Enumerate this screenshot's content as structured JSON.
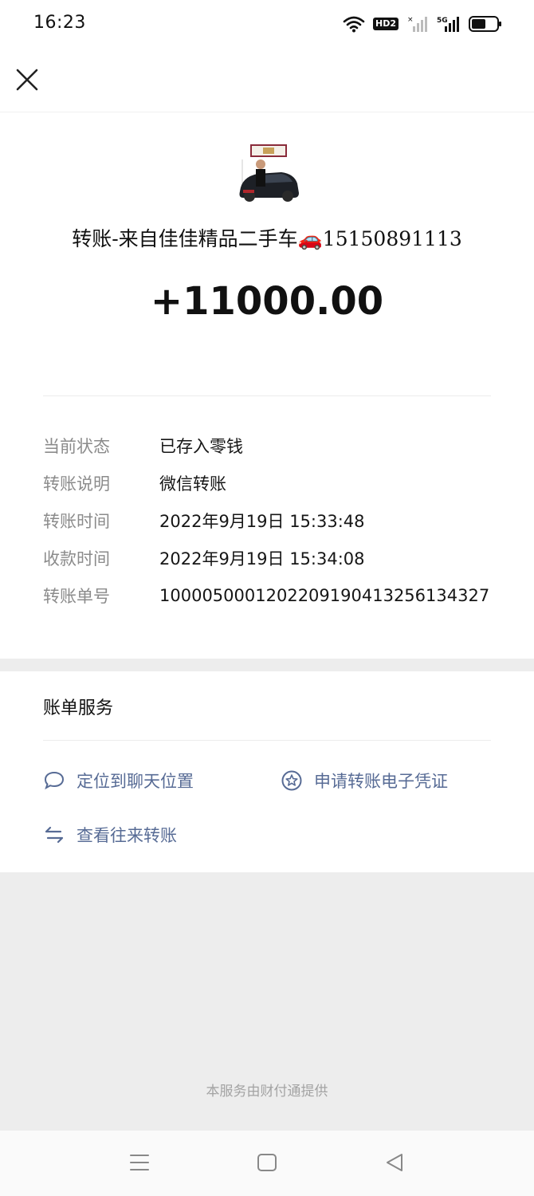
{
  "status_bar": {
    "time": "16:23",
    "icons": [
      "wifi-icon",
      "hd-voice-icon",
      "signal-no-service-icon",
      "5g-signal-icon",
      "battery-icon"
    ],
    "hd_label": "HD2",
    "network_label": "5G"
  },
  "header": {
    "close_icon": "close-icon"
  },
  "transfer": {
    "title": "转账-来自佳佳精品二手车🚗15150891113",
    "amount": "+11000.00"
  },
  "details": [
    {
      "key": "当前状态",
      "value": "已存入零钱"
    },
    {
      "key": "转账说明",
      "value": "微信转账"
    },
    {
      "key": "转账时间",
      "value": "2022年9月19日  15:33:48"
    },
    {
      "key": "收款时间",
      "value": "2022年9月19日  15:34:08"
    },
    {
      "key": "转账单号",
      "value": "1000050001202209190413256134327"
    }
  ],
  "services": {
    "title": "账单服务",
    "links": [
      {
        "label": "定位到聊天位置",
        "icon": "chat-bubble-icon"
      },
      {
        "label": "申请转账电子凭证",
        "icon": "star-badge-icon"
      },
      {
        "label": "查看往来转账",
        "icon": "transfer-arrows-icon"
      }
    ]
  },
  "footer": {
    "note": "本服务由财付通提供"
  },
  "colors": {
    "link": "#576b95",
    "label": "#8b8b8b",
    "background_gray": "#ededed"
  }
}
